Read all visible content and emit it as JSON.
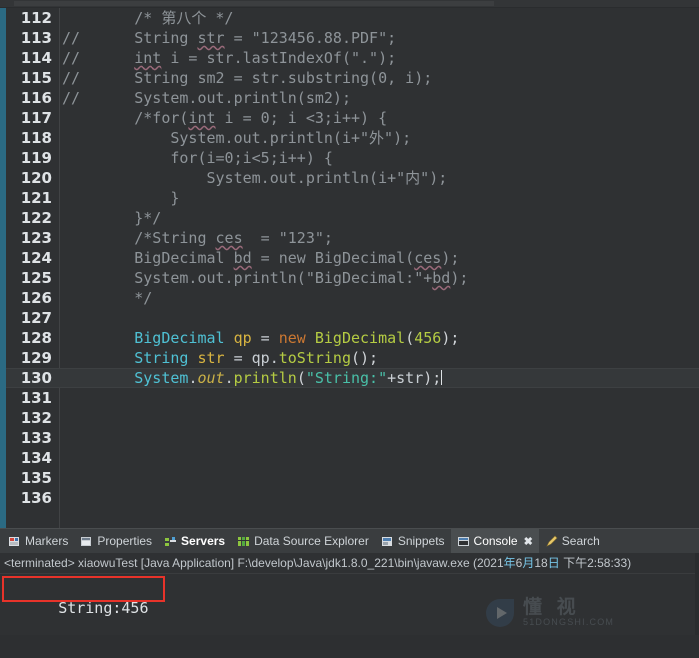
{
  "editor": {
    "gutter_accent_color": "#2b6a83",
    "background": "#2f3133",
    "current_line": 130,
    "lines": [
      {
        "num": "112",
        "marker": "",
        "indent": 8,
        "tokens": [
          {
            "t": "/* 第八个 */",
            "c": "c-comment"
          }
        ]
      },
      {
        "num": "113",
        "marker": "//",
        "indent": 8,
        "tokens": [
          {
            "t": "String ",
            "c": "c-comment"
          },
          {
            "t": "str",
            "c": "c-comment warn"
          },
          {
            "t": " = \"123456.88.PDF\";",
            "c": "c-comment"
          }
        ]
      },
      {
        "num": "114",
        "marker": "//",
        "indent": 8,
        "tokens": [
          {
            "t": "int",
            "c": "c-comment warn"
          },
          {
            "t": " i = str.lastIndexOf(\".\");",
            "c": "c-comment"
          }
        ]
      },
      {
        "num": "115",
        "marker": "//",
        "indent": 8,
        "tokens": [
          {
            "t": "String sm2 = str.substring(0, i);",
            "c": "c-comment"
          }
        ]
      },
      {
        "num": "116",
        "marker": "//",
        "indent": 8,
        "tokens": [
          {
            "t": "System.out.println(sm2);",
            "c": "c-comment"
          }
        ]
      },
      {
        "num": "117",
        "marker": "",
        "indent": 8,
        "tokens": [
          {
            "t": "/*for(",
            "c": "c-comment"
          },
          {
            "t": "int",
            "c": "c-comment warn"
          },
          {
            "t": " i = 0; i <3;i++) {",
            "c": "c-comment"
          }
        ]
      },
      {
        "num": "118",
        "marker": "",
        "indent": 12,
        "tokens": [
          {
            "t": "System.out.println(i+\"外\");",
            "c": "c-comment"
          }
        ]
      },
      {
        "num": "119",
        "marker": "",
        "indent": 12,
        "tokens": [
          {
            "t": "for(i=0;i<5;i++) {",
            "c": "c-comment"
          }
        ]
      },
      {
        "num": "120",
        "marker": "",
        "indent": 16,
        "tokens": [
          {
            "t": "System.out.println(i+\"内\");",
            "c": "c-comment"
          }
        ]
      },
      {
        "num": "121",
        "marker": "",
        "indent": 12,
        "tokens": [
          {
            "t": "}",
            "c": "c-comment"
          }
        ]
      },
      {
        "num": "122",
        "marker": "",
        "indent": 8,
        "tokens": [
          {
            "t": "}*/",
            "c": "c-comment"
          }
        ]
      },
      {
        "num": "123",
        "marker": "",
        "indent": 8,
        "tokens": [
          {
            "t": "/*String ",
            "c": "c-comment"
          },
          {
            "t": "ces",
            "c": "c-comment warn"
          },
          {
            "t": "  = \"123\";",
            "c": "c-comment"
          }
        ]
      },
      {
        "num": "124",
        "marker": "",
        "indent": 8,
        "tokens": [
          {
            "t": "BigDecimal ",
            "c": "c-comment"
          },
          {
            "t": "bd",
            "c": "c-comment warn"
          },
          {
            "t": " = new BigDecimal(",
            "c": "c-comment"
          },
          {
            "t": "ces",
            "c": "c-comment warn"
          },
          {
            "t": ");",
            "c": "c-comment"
          }
        ]
      },
      {
        "num": "125",
        "marker": "",
        "indent": 8,
        "tokens": [
          {
            "t": "System.out.println(\"BigDecimal:\"+",
            "c": "c-comment"
          },
          {
            "t": "bd",
            "c": "c-comment warn"
          },
          {
            "t": ");",
            "c": "c-comment"
          }
        ]
      },
      {
        "num": "126",
        "marker": "",
        "indent": 8,
        "tokens": [
          {
            "t": "*/",
            "c": "c-comment"
          }
        ]
      },
      {
        "num": "127",
        "marker": "",
        "indent": 0,
        "tokens": []
      },
      {
        "num": "128",
        "marker": "",
        "indent": 8,
        "tokens": [
          {
            "t": "BigDecimal",
            "c": "c-type"
          },
          {
            "t": " ",
            "c": "c-plain"
          },
          {
            "t": "qp",
            "c": "c-var"
          },
          {
            "t": " = ",
            "c": "c-plain"
          },
          {
            "t": "new",
            "c": "c-kw"
          },
          {
            "t": " ",
            "c": "c-plain"
          },
          {
            "t": "BigDecimal",
            "c": "c-meth"
          },
          {
            "t": "(",
            "c": "c-paren"
          },
          {
            "t": "456",
            "c": "c-num"
          },
          {
            "t": ");",
            "c": "c-paren"
          }
        ]
      },
      {
        "num": "129",
        "marker": "",
        "indent": 8,
        "tokens": [
          {
            "t": "String",
            "c": "c-type"
          },
          {
            "t": " ",
            "c": "c-plain"
          },
          {
            "t": "str",
            "c": "c-var"
          },
          {
            "t": " = ",
            "c": "c-plain"
          },
          {
            "t": "qp",
            "c": "c-plain"
          },
          {
            "t": ".",
            "c": "c-plain"
          },
          {
            "t": "toString",
            "c": "c-meth"
          },
          {
            "t": "();",
            "c": "c-paren"
          }
        ]
      },
      {
        "num": "130",
        "marker": "",
        "indent": 8,
        "tokens": [
          {
            "t": "System",
            "c": "c-type"
          },
          {
            "t": ".",
            "c": "c-plain"
          },
          {
            "t": "out",
            "c": "c-field"
          },
          {
            "t": ".",
            "c": "c-plain"
          },
          {
            "t": "println",
            "c": "c-meth"
          },
          {
            "t": "(",
            "c": "c-paren"
          },
          {
            "t": "\"String:\"",
            "c": "c-str"
          },
          {
            "t": "+",
            "c": "c-plain"
          },
          {
            "t": "str",
            "c": "c-plain"
          },
          {
            "t": ");",
            "c": "c-paren"
          }
        ],
        "caret": true
      },
      {
        "num": "131",
        "marker": "",
        "indent": 0,
        "tokens": []
      },
      {
        "num": "132",
        "marker": "",
        "indent": 0,
        "tokens": []
      },
      {
        "num": "133",
        "marker": "",
        "indent": 0,
        "tokens": []
      },
      {
        "num": "134",
        "marker": "",
        "indent": 0,
        "tokens": []
      },
      {
        "num": "135",
        "marker": "",
        "indent": 0,
        "tokens": []
      },
      {
        "num": "136",
        "marker": "",
        "indent": 0,
        "tokens": []
      }
    ]
  },
  "view_tabs": [
    {
      "label": "Markers",
      "icon": "markers-icon",
      "state": "inactive"
    },
    {
      "label": "Properties",
      "icon": "properties-icon",
      "state": "inactive"
    },
    {
      "label": "Servers",
      "icon": "servers-icon",
      "state": "bold"
    },
    {
      "label": "Data Source Explorer",
      "icon": "data-source-explorer-icon",
      "state": "inactive"
    },
    {
      "label": "Snippets",
      "icon": "snippets-icon",
      "state": "inactive"
    },
    {
      "label": "Console",
      "icon": "console-icon",
      "state": "active",
      "close": "✖"
    },
    {
      "label": "Search",
      "icon": "search-icon",
      "state": "inactive"
    }
  ],
  "console": {
    "status_prefix": "<terminated> xiaowuTest [Java Application] F:\\develop\\Java\\jdk1.8.0_221\\bin\\javaw.exe (2021",
    "status_year_cn": "年",
    "status_mid": "6",
    "status_month_cn": "月",
    "status_day": "18",
    "status_day_cn": "日",
    "status_time": " 下午2:58:33)",
    "output": "String:456",
    "highlight_box_color": "#e8332a"
  },
  "watermark": {
    "cn": "懂 视",
    "en": "51DONGSHI.COM"
  }
}
